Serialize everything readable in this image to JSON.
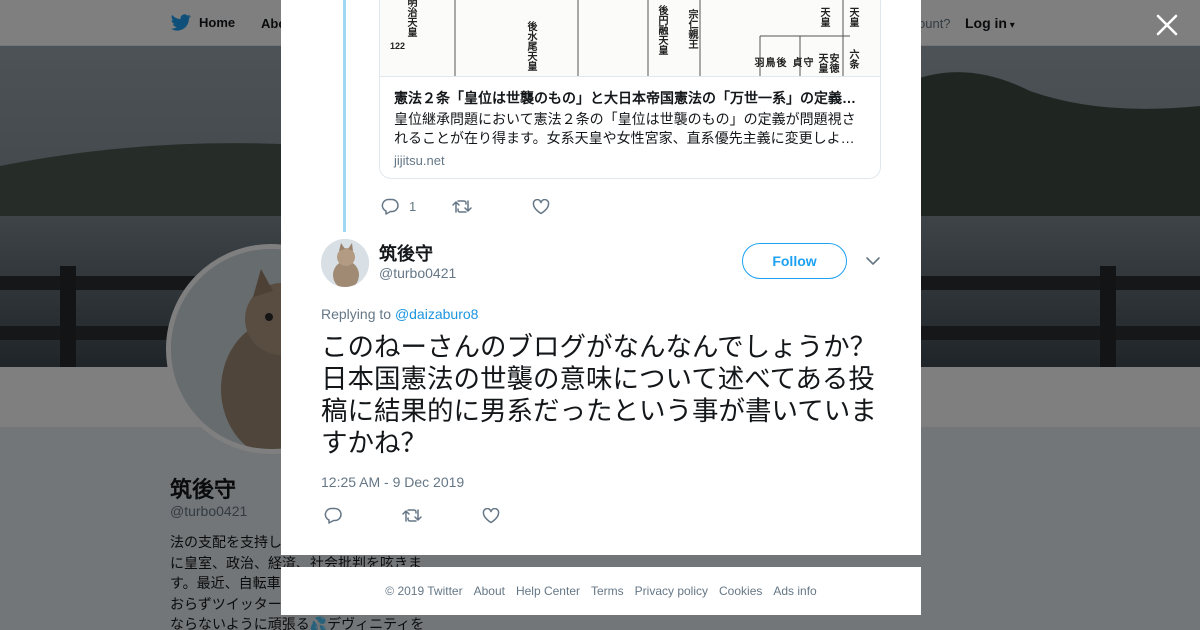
{
  "colors": {
    "accent": "#1da1f2",
    "thread_line": "#9fd8f2",
    "text": "#14171a",
    "muted": "#657786"
  },
  "topnav": {
    "home_label": "Home",
    "about_label": "Abo",
    "account_question": "ccount?",
    "login_label": "Log in",
    "logo_icon": "twitter-bird-icon"
  },
  "background_profile": {
    "name": "筑後守",
    "handle": "@turbo0421",
    "bio_lines": [
      "法の支配を支持し",
      "に皇室、政治、経済、社会批判を呟きま",
      "す。最近、自転車",
      "おらずツイッター",
      "ならないように頑張る💦デヴィニティを"
    ]
  },
  "close_icon": "close-x-icon",
  "link_card": {
    "image_labels": [
      "明治天皇",
      "122",
      "後水尾天皇",
      "後円融天皇",
      "宗仁親王",
      "天皇",
      "天皇",
      "安徳天皇",
      "六条",
      "後鳥羽",
      "守貞"
    ],
    "title": "憲法２条「皇位は世襲のもの」と大日本帝国憲法の「万世一系」の定義…",
    "description": "皇位継承問題において憲法２条の「皇位は世襲のもの」の定義が問題視されることが在り得ます。女系天皇や女性宮家、直系優先主義に変更しよ…",
    "domain": "jijitsu.net"
  },
  "parent_actions": {
    "reply_count": "1",
    "reply_icon": "reply-icon",
    "retweet_icon": "retweet-icon",
    "like_icon": "heart-icon"
  },
  "tweet": {
    "author_name": "筑後守",
    "author_handle": "@turbo0421",
    "follow_label": "Follow",
    "caret_icon": "chevron-down-icon",
    "replying_to_prefix": "Replying to",
    "replying_to_mention": "@daizaburo8",
    "text": "このねーさんのブログがなんなんでしょうか？日本国憲法の世襲の意味について述べてある投稿に結果的に男系だったという事が書いていますかね？",
    "timestamp": "12:25 AM - 9 Dec 2019"
  },
  "footer": {
    "copyright": "© 2019 Twitter",
    "links": [
      "About",
      "Help Center",
      "Terms",
      "Privacy policy",
      "Cookies",
      "Ads info"
    ]
  }
}
